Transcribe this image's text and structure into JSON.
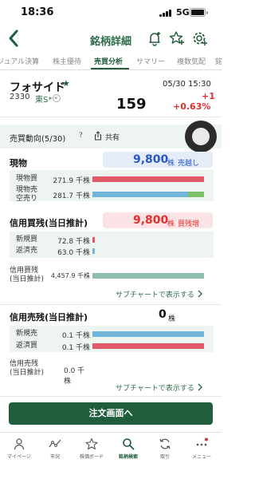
{
  "status_bar": {
    "time": "18:36",
    "network": "5G"
  },
  "nav": {
    "title": "銘柄詳細"
  },
  "tabs": [
    {
      "label": "ジュアル決算"
    },
    {
      "label": "株主優待"
    },
    {
      "label": "売買分析"
    },
    {
      "label": "サマリー"
    },
    {
      "label": "複数気配"
    },
    {
      "label": "銘"
    }
  ],
  "stock": {
    "name": "フォサイド",
    "code": "2330",
    "exchange": "東S*",
    "datetime": "05/30 15:30",
    "price": "159",
    "change": "+1",
    "change_pct": "+0.63%"
  },
  "trend": {
    "title": "売買動向(5/30)",
    "help": "?",
    "share": "共有"
  },
  "spot": {
    "title": "現物",
    "value": "9,800",
    "unit": "株",
    "status": "売越し",
    "rows": [
      {
        "label": "現物買",
        "value": "271.9 千株",
        "fill": 1.0
      },
      {
        "label": "現物売\n空売り",
        "value": "281.7 千株",
        "fill": 0.86,
        "fill2": 0.14
      }
    ]
  },
  "margin_buy": {
    "title": "信用買残(当日推計)",
    "value": "9,800",
    "unit": "株",
    "status": "買残増",
    "rows": [
      {
        "label": "新規買",
        "value": "72.8 千株",
        "fill": 0.02
      },
      {
        "label": "返済売",
        "value": "63.0 千株",
        "fill": 0.02
      }
    ],
    "balance": {
      "label": "信用買残\n(当日推計)",
      "value": "4,457.9 千株",
      "fill": 1.0
    },
    "link": "サブチャートで表示する"
  },
  "margin_sell": {
    "title": "信用売残(当日推計)",
    "value": "0",
    "unit": "株",
    "rows": [
      {
        "label": "新規売",
        "value": "0.1 千株",
        "fill": 1.0
      },
      {
        "label": "返済買",
        "value": "0.1 千株",
        "fill": 1.0
      }
    ],
    "balance": {
      "label": "信用売残\n(当日推計)",
      "value": "0.0 千株"
    },
    "link": "サブチャートで表示する"
  },
  "cta": {
    "label": "注文画面へ"
  },
  "tabbar": [
    {
      "label": "マイページ",
      "icon": "person-icon"
    },
    {
      "label": "市況",
      "icon": "market-icon"
    },
    {
      "label": "株価ボード",
      "icon": "star-icon"
    },
    {
      "label": "銘柄検索",
      "icon": "search-icon"
    },
    {
      "label": "取引",
      "icon": "trade-icon"
    },
    {
      "label": "メニュー",
      "icon": "more-icon"
    }
  ],
  "colors": {
    "brand": "#1f5d3b",
    "red": "#e03030",
    "buy_bar": "#e05a6a",
    "sell_bar": "#6fb6d8",
    "short_bar": "#7cc06a",
    "balance_bar": "#8fbdb0"
  }
}
